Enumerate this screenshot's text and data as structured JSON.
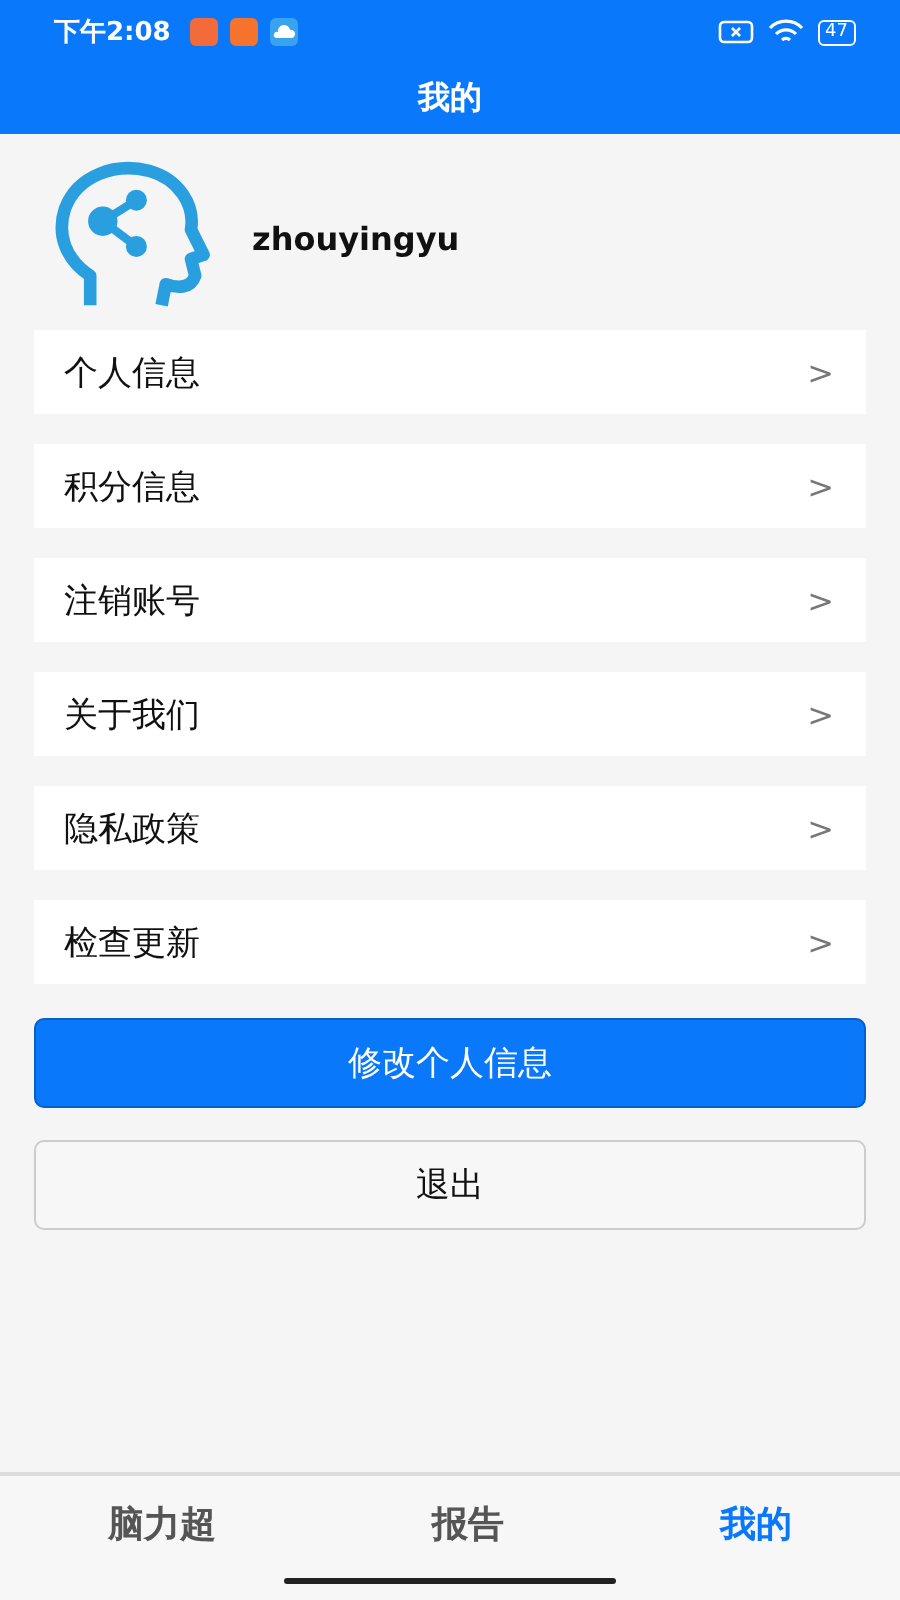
{
  "status_bar": {
    "time": "下午2:08",
    "battery": "47"
  },
  "header": {
    "title": "我的"
  },
  "profile": {
    "username": "zhouyingyu"
  },
  "menu": [
    {
      "label": "个人信息",
      "arrow": ">"
    },
    {
      "label": "积分信息",
      "arrow": ">"
    },
    {
      "label": "注销账号",
      "arrow": ">"
    },
    {
      "label": "关于我们",
      "arrow": ">"
    },
    {
      "label": "隐私政策",
      "arrow": ">"
    },
    {
      "label": "检查更新",
      "arrow": ">"
    }
  ],
  "buttons": [
    {
      "label": "修改个人信息",
      "kind": "primary"
    },
    {
      "label": "退出",
      "kind": "outline"
    }
  ],
  "tabs": [
    {
      "label": "脑力超",
      "selected": false
    },
    {
      "label": "报告",
      "selected": false
    },
    {
      "label": "我的",
      "selected": true
    }
  ]
}
